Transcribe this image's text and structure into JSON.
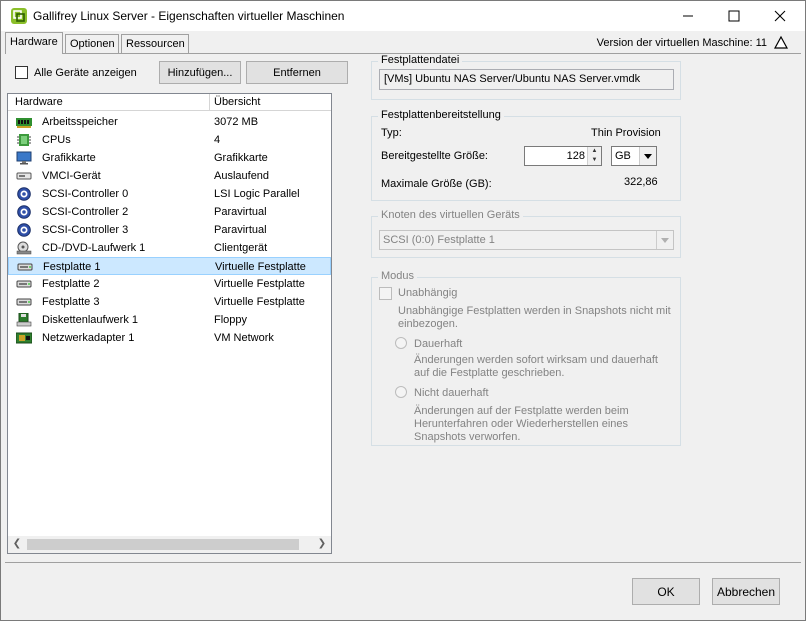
{
  "window": {
    "title": "Gallifrey Linux Server - Eigenschaften virtueller Maschinen",
    "controls": {
      "minimize": "–",
      "maximize": "☐",
      "close": "✕"
    }
  },
  "tabs": [
    {
      "label": "Hardware",
      "active": true
    },
    {
      "label": "Optionen",
      "active": false
    },
    {
      "label": "Ressourcen",
      "active": false
    }
  ],
  "version_label": "Version der virtuellen Maschine: 11",
  "left": {
    "show_all_label": "Alle Geräte anzeigen",
    "add_button": "Hinzufügen...",
    "remove_button": "Entfernen",
    "columns": [
      "Hardware",
      "Übersicht"
    ],
    "rows": [
      {
        "name": "Arbeitsspeicher",
        "value": "3072 MB",
        "icon": "memory-icon"
      },
      {
        "name": "CPUs",
        "value": "4",
        "icon": "cpu-icon"
      },
      {
        "name": "Grafikkarte",
        "value": "Grafikkarte",
        "icon": "monitor-icon"
      },
      {
        "name": "VMCI-Gerät",
        "value": "Auslaufend",
        "icon": "vmci-device-icon"
      },
      {
        "name": "SCSI-Controller 0",
        "value": "LSI Logic Parallel",
        "icon": "scsi-controller-icon"
      },
      {
        "name": "SCSI-Controller 2",
        "value": "Paravirtual",
        "icon": "scsi-controller-icon"
      },
      {
        "name": "SCSI-Controller 3",
        "value": "Paravirtual",
        "icon": "scsi-controller-icon"
      },
      {
        "name": "CD-/DVD-Laufwerk 1",
        "value": "Clientgerät",
        "icon": "cd-dvd-drive-icon"
      },
      {
        "name": "Festplatte 1",
        "value": "Virtuelle Festplatte",
        "icon": "hard-disk-icon",
        "selected": true
      },
      {
        "name": "Festplatte 2",
        "value": "Virtuelle Festplatte",
        "icon": "hard-disk-icon"
      },
      {
        "name": "Festplatte 3",
        "value": "Virtuelle Festplatte",
        "icon": "hard-disk-icon"
      },
      {
        "name": "Diskettenlaufwerk 1",
        "value": "Floppy",
        "icon": "floppy-drive-icon"
      },
      {
        "name": "Netzwerkadapter 1",
        "value": "VM Network",
        "icon": "network-adapter-icon"
      }
    ]
  },
  "right": {
    "disk_file": {
      "legend": "Festplattendatei",
      "value": "[VMs] Ubuntu NAS Server/Ubuntu NAS Server.vmdk"
    },
    "provisioning": {
      "legend": "Festplattenbereitstellung",
      "type_label": "Typ:",
      "type_value": "Thin Provision",
      "size_label": "Bereitgestellte Größe:",
      "size_value": "128",
      "unit_value": "GB",
      "max_label": "Maximale Größe (GB):",
      "max_value": "322,86"
    },
    "node": {
      "legend": "Knoten des virtuellen Geräts",
      "value": "SCSI (0:0) Festplatte 1"
    },
    "mode": {
      "legend": "Modus",
      "independent_label": "Unabhängig",
      "independent_desc": "Unabhängige Festplatten werden in Snapshots nicht mit einbezogen.",
      "persistent_label": "Dauerhaft",
      "persistent_desc": "Änderungen werden sofort wirksam und dauerhaft auf die Festplatte geschrieben.",
      "nonpersistent_label": "Nicht dauerhaft",
      "nonpersistent_desc": "Änderungen auf der Festplatte werden beim Herunterfahren oder Wiederherstellen eines Snapshots verworfen."
    }
  },
  "footer": {
    "ok_label": "OK",
    "cancel_label": "Abbrechen"
  }
}
